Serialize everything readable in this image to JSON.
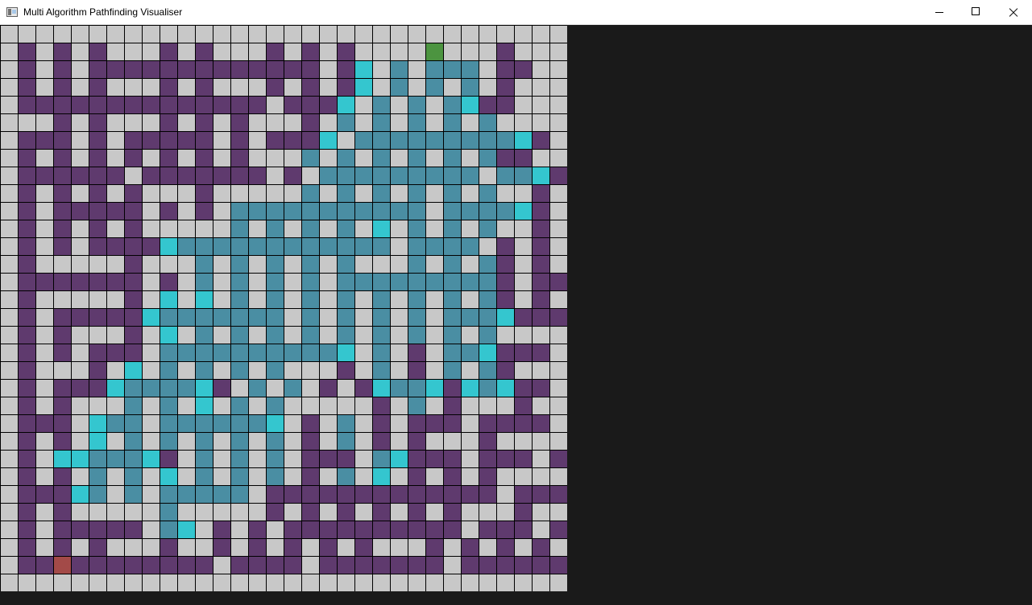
{
  "window": {
    "title": "Multi Algorithm Pathfinding Visualiser",
    "icon": "app-window-icon",
    "controls": [
      "minimize-icon",
      "maximize-icon",
      "close-icon"
    ]
  },
  "grid": {
    "rows": 32,
    "cols": 32,
    "colors": {
      "empty": "#c8c8c8",
      "wall": "#5f3a6e",
      "visited": "#4a8ea3",
      "frontier": "#34c6cf",
      "start": "#4c9440",
      "end": "#a34a48",
      "gridline": "#000000"
    },
    "legend": {
      ".": "empty",
      "#": "wall",
      "v": "visited",
      "f": "frontier",
      "S": "start",
      "E": "end"
    },
    "cells": [
      "................................",
      ".#.#.#...#.#...#.#.#....S...#...",
      ".#.#.#############.#f.v.vvv.##..",
      ".#.#.#...#.#...#.#.#f.v.v.v.#...",
      ".##############.###f.v.v.vf##...",
      "...#.#...#.#.#...#.v.v.v.v.v....",
      ".###.#.#####.#.###f.vvvvvvvvvf#.",
      ".#.#.#.#.#.#.#...v.v.v.v.v.v##..",
      ".######.#######.#.vvvvvvvvv.vvf#",
      ".#.#.#.#...#.....v.v.v.v.v.v..#.",
      ".#.#####.#.#.vvvvvvvvvvv.vvvvf#.",
      ".#.#.#.#.....v.v.v.v.f.v.v.v..#.",
      ".#.#.####fvvvvvvvvvvvv.vvvv.#.#.",
      ".#.....#...v.v.v.v.v...v.v.v#.#.",
      ".#######.#.v.v.v.v.vvvvvvvvv#.##",
      ".#.....#.f.f.v.v.v.v.v.v.v.v#.#.",
      ".#.#####fvvvvvvv.v.v.v.v.vvvf###",
      ".#.#...#.f.v.v.v.v.v.v.v.v.v....",
      ".#.#.###.vvvvvvvvvvf.v.#.vvf###.",
      ".#...#.f.v.v.v.v...#.v.#.v.v#...",
      ".#.###fvvvvf#.v.v.#.#fvvf#fvf##.",
      ".#.#...v.v.f.v.v.....#.v.#...#..",
      ".###.fvv.vvvvvvf.#.v.#.###.####.",
      ".#.#.f.v.v.v.v.v.#.v.#.#...#....",
      ".#.ffvvvf#.v.v.v.###.vf###.###.#",
      ".#.#.v.v.f.v.v.v.#.v.f.#.#.#....",
      ".###fv.v.vvvvv.#############.###",
      ".#.#.....v.....#.#.#.#.#.#...#..",
      ".#.#####.vf.#.#.##########.###.#",
      ".#.#.#...#..#.#.#.#.#...#.#.#.#.",
      ".##E########.####.#######.######",
      "................................"
    ]
  }
}
